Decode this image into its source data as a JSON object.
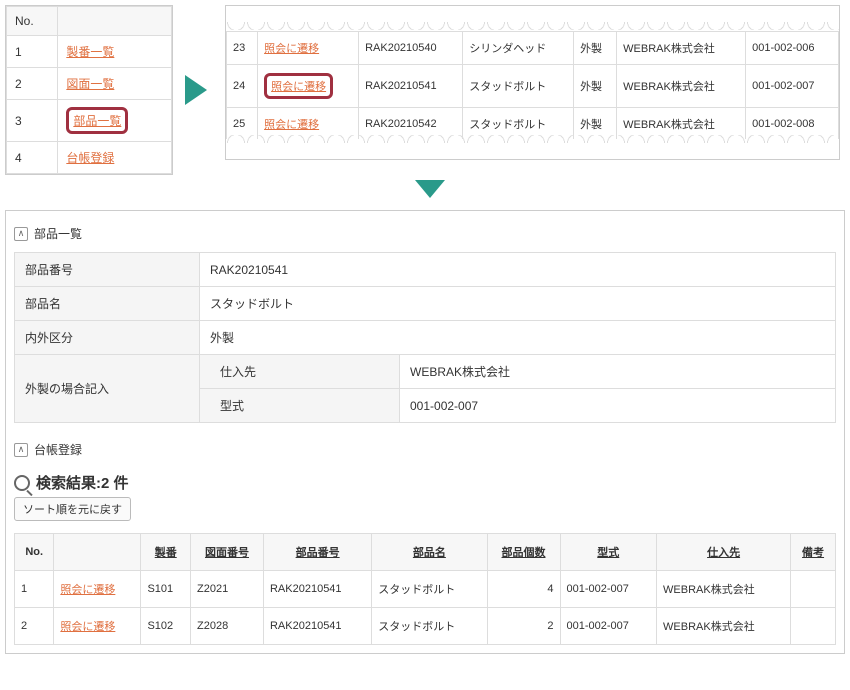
{
  "menu": {
    "header_no": "No.",
    "items": [
      {
        "no": "1",
        "label": "製番一覧"
      },
      {
        "no": "2",
        "label": "図面一覧"
      },
      {
        "no": "3",
        "label": "部品一覧"
      },
      {
        "no": "4",
        "label": "台帳登録"
      }
    ]
  },
  "top_list": {
    "link_label": "照会に遷移",
    "rows": [
      {
        "no": "23",
        "part_no": "RAK20210540",
        "name": "シリンダヘッド",
        "cat": "外製",
        "vendor": "WEBRAK株式会社",
        "model": "001-002-006"
      },
      {
        "no": "24",
        "part_no": "RAK20210541",
        "name": "スタッドボルト",
        "cat": "外製",
        "vendor": "WEBRAK株式会社",
        "model": "001-002-007"
      },
      {
        "no": "25",
        "part_no": "RAK20210542",
        "name": "スタッドボルト",
        "cat": "外製",
        "vendor": "WEBRAK株式会社",
        "model": "001-002-008"
      }
    ]
  },
  "detail": {
    "section1_title": "部品一覧",
    "labels": {
      "part_no": "部品番号",
      "part_name": "部品名",
      "category": "内外区分",
      "external_note": "外製の場合記入",
      "vendor": "仕入先",
      "model": "型式"
    },
    "values": {
      "part_no": "RAK20210541",
      "part_name": "スタッドボルト",
      "category": "外製",
      "vendor": "WEBRAK株式会社",
      "model": "001-002-007"
    },
    "section2_title": "台帳登録"
  },
  "search": {
    "result_label": "検索結果:2 件",
    "reset_button": "ソート順を元に戻す",
    "headers": {
      "no": "No.",
      "seiban": "製番",
      "zumen": "図面番号",
      "part_no": "部品番号",
      "part_name": "部品名",
      "qty": "部品個数",
      "model": "型式",
      "vendor": "仕入先",
      "remarks": "備考"
    },
    "link_label": "照会に遷移",
    "rows": [
      {
        "no": "1",
        "seiban": "S101",
        "zumen": "Z2021",
        "part_no": "RAK20210541",
        "part_name": "スタッドボルト",
        "qty": "4",
        "model": "001-002-007",
        "vendor": "WEBRAK株式会社",
        "remarks": ""
      },
      {
        "no": "2",
        "seiban": "S102",
        "zumen": "Z2028",
        "part_no": "RAK20210541",
        "part_name": "スタッドボルト",
        "qty": "2",
        "model": "001-002-007",
        "vendor": "WEBRAK株式会社",
        "remarks": ""
      }
    ]
  }
}
